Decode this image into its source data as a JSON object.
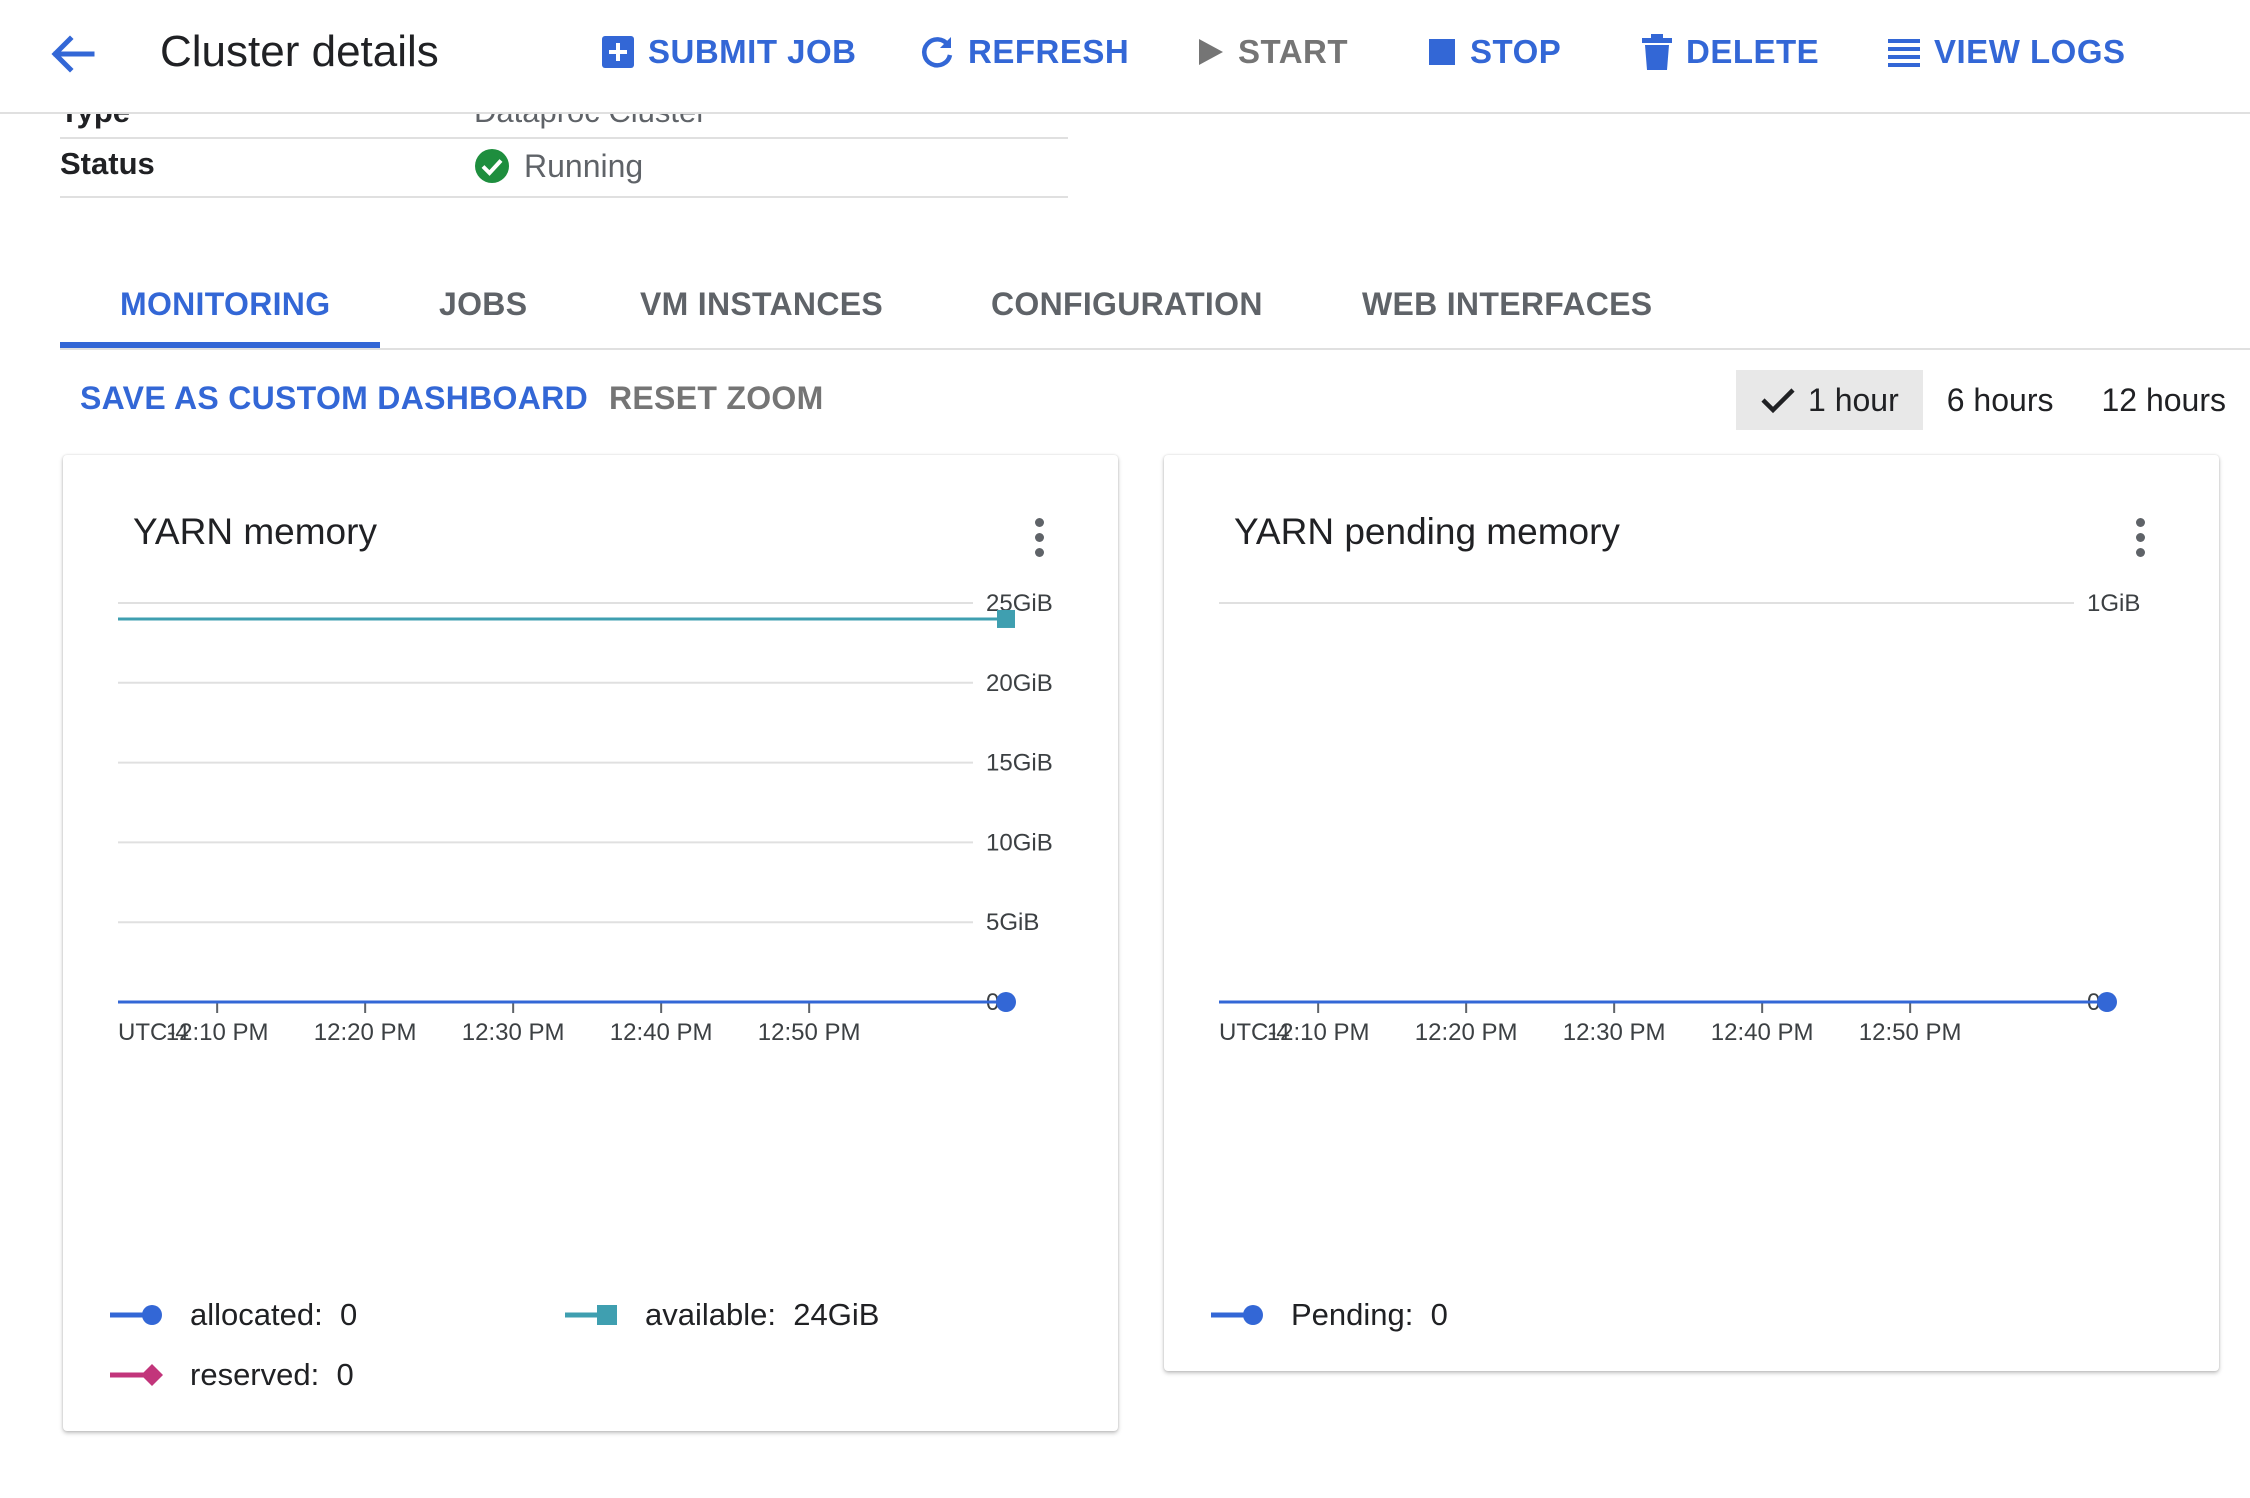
{
  "header": {
    "title": "Cluster details",
    "toolbar": {
      "submit_job": "SUBMIT JOB",
      "refresh": "REFRESH",
      "start": "START",
      "stop": "STOP",
      "delete": "DELETE",
      "view_logs": "VIEW LOGS"
    }
  },
  "details": {
    "type_label": "Type",
    "type_value": "Dataproc Cluster",
    "status_label": "Status",
    "status_value": "Running"
  },
  "tabs": [
    {
      "label": "MONITORING",
      "active": true
    },
    {
      "label": "JOBS"
    },
    {
      "label": "VM INSTANCES"
    },
    {
      "label": "CONFIGURATION"
    },
    {
      "label": "WEB INTERFACES"
    }
  ],
  "actions": {
    "save_dashboard": "SAVE AS CUSTOM DASHBOARD",
    "reset_zoom": "RESET ZOOM"
  },
  "time_range": {
    "options": [
      "1 hour",
      "6 hours",
      "12 hours"
    ],
    "selected": "1 hour"
  },
  "colors": {
    "accent": "#3367d6",
    "success": "#1e8e3e",
    "allocated": "#3367d6",
    "available": "#3f9fb0",
    "reserved": "#c2357b"
  },
  "chart_data": [
    {
      "type": "line",
      "title": "YARN memory",
      "timezone": "UTC-4",
      "x_ticks": [
        "12:10 PM",
        "12:20 PM",
        "12:30 PM",
        "12:40 PM",
        "12:50 PM"
      ],
      "y_ticks": [
        "0",
        "5GiB",
        "10GiB",
        "15GiB",
        "20GiB",
        "25GiB"
      ],
      "ylim": [
        0,
        25
      ],
      "y_unit": "GiB",
      "x_range_minutes": [
        0,
        60
      ],
      "grid": true,
      "series": [
        {
          "name": "allocated",
          "value_label": "0",
          "color": "#3367d6",
          "marker": "circle",
          "points": [
            [
              0,
              0
            ],
            [
              60,
              0
            ]
          ]
        },
        {
          "name": "available",
          "value_label": "24GiB",
          "color": "#3f9fb0",
          "marker": "square",
          "points": [
            [
              0,
              24
            ],
            [
              60,
              24
            ]
          ]
        },
        {
          "name": "reserved",
          "value_label": "0",
          "color": "#c2357b",
          "marker": "diamond",
          "points": [
            [
              0,
              0
            ],
            [
              60,
              0
            ]
          ]
        }
      ]
    },
    {
      "type": "line",
      "title": "YARN pending memory",
      "timezone": "UTC-4",
      "x_ticks": [
        "12:10 PM",
        "12:20 PM",
        "12:30 PM",
        "12:40 PM",
        "12:50 PM"
      ],
      "y_ticks": [
        "0",
        "1GiB"
      ],
      "ylim": [
        0,
        1
      ],
      "y_unit": "GiB",
      "x_range_minutes": [
        0,
        60
      ],
      "grid": true,
      "series": [
        {
          "name": "Pending",
          "value_label": "0",
          "color": "#3367d6",
          "marker": "circle",
          "points": [
            [
              0,
              0
            ],
            [
              60,
              0
            ]
          ]
        }
      ]
    }
  ]
}
